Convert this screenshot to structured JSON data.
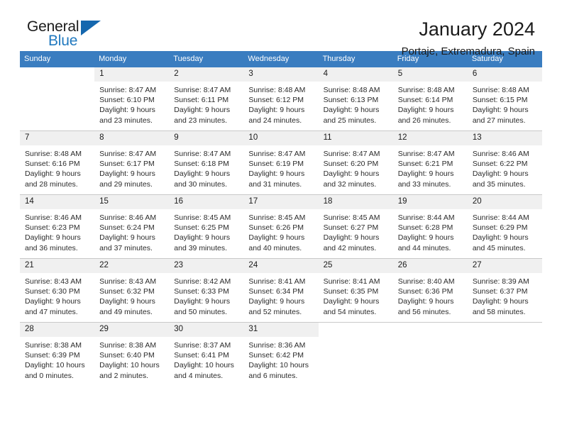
{
  "brand": {
    "word_general": "General",
    "word_blue": "Blue",
    "accent_color": "#1567ae"
  },
  "header": {
    "title": "January 2024",
    "location": "Portaje, Extremadura, Spain",
    "header_bg": "#3a7dc0",
    "daynum_bg": "#f0f0f0"
  },
  "weekdays": [
    "Sunday",
    "Monday",
    "Tuesday",
    "Wednesday",
    "Thursday",
    "Friday",
    "Saturday"
  ],
  "weeks": [
    [
      {
        "day": "",
        "sunrise": "",
        "sunset": "",
        "daylight1": "",
        "daylight2": ""
      },
      {
        "day": "1",
        "sunrise": "Sunrise: 8:47 AM",
        "sunset": "Sunset: 6:10 PM",
        "daylight1": "Daylight: 9 hours",
        "daylight2": "and 23 minutes."
      },
      {
        "day": "2",
        "sunrise": "Sunrise: 8:47 AM",
        "sunset": "Sunset: 6:11 PM",
        "daylight1": "Daylight: 9 hours",
        "daylight2": "and 23 minutes."
      },
      {
        "day": "3",
        "sunrise": "Sunrise: 8:48 AM",
        "sunset": "Sunset: 6:12 PM",
        "daylight1": "Daylight: 9 hours",
        "daylight2": "and 24 minutes."
      },
      {
        "day": "4",
        "sunrise": "Sunrise: 8:48 AM",
        "sunset": "Sunset: 6:13 PM",
        "daylight1": "Daylight: 9 hours",
        "daylight2": "and 25 minutes."
      },
      {
        "day": "5",
        "sunrise": "Sunrise: 8:48 AM",
        "sunset": "Sunset: 6:14 PM",
        "daylight1": "Daylight: 9 hours",
        "daylight2": "and 26 minutes."
      },
      {
        "day": "6",
        "sunrise": "Sunrise: 8:48 AM",
        "sunset": "Sunset: 6:15 PM",
        "daylight1": "Daylight: 9 hours",
        "daylight2": "and 27 minutes."
      }
    ],
    [
      {
        "day": "7",
        "sunrise": "Sunrise: 8:48 AM",
        "sunset": "Sunset: 6:16 PM",
        "daylight1": "Daylight: 9 hours",
        "daylight2": "and 28 minutes."
      },
      {
        "day": "8",
        "sunrise": "Sunrise: 8:47 AM",
        "sunset": "Sunset: 6:17 PM",
        "daylight1": "Daylight: 9 hours",
        "daylight2": "and 29 minutes."
      },
      {
        "day": "9",
        "sunrise": "Sunrise: 8:47 AM",
        "sunset": "Sunset: 6:18 PM",
        "daylight1": "Daylight: 9 hours",
        "daylight2": "and 30 minutes."
      },
      {
        "day": "10",
        "sunrise": "Sunrise: 8:47 AM",
        "sunset": "Sunset: 6:19 PM",
        "daylight1": "Daylight: 9 hours",
        "daylight2": "and 31 minutes."
      },
      {
        "day": "11",
        "sunrise": "Sunrise: 8:47 AM",
        "sunset": "Sunset: 6:20 PM",
        "daylight1": "Daylight: 9 hours",
        "daylight2": "and 32 minutes."
      },
      {
        "day": "12",
        "sunrise": "Sunrise: 8:47 AM",
        "sunset": "Sunset: 6:21 PM",
        "daylight1": "Daylight: 9 hours",
        "daylight2": "and 33 minutes."
      },
      {
        "day": "13",
        "sunrise": "Sunrise: 8:46 AM",
        "sunset": "Sunset: 6:22 PM",
        "daylight1": "Daylight: 9 hours",
        "daylight2": "and 35 minutes."
      }
    ],
    [
      {
        "day": "14",
        "sunrise": "Sunrise: 8:46 AM",
        "sunset": "Sunset: 6:23 PM",
        "daylight1": "Daylight: 9 hours",
        "daylight2": "and 36 minutes."
      },
      {
        "day": "15",
        "sunrise": "Sunrise: 8:46 AM",
        "sunset": "Sunset: 6:24 PM",
        "daylight1": "Daylight: 9 hours",
        "daylight2": "and 37 minutes."
      },
      {
        "day": "16",
        "sunrise": "Sunrise: 8:45 AM",
        "sunset": "Sunset: 6:25 PM",
        "daylight1": "Daylight: 9 hours",
        "daylight2": "and 39 minutes."
      },
      {
        "day": "17",
        "sunrise": "Sunrise: 8:45 AM",
        "sunset": "Sunset: 6:26 PM",
        "daylight1": "Daylight: 9 hours",
        "daylight2": "and 40 minutes."
      },
      {
        "day": "18",
        "sunrise": "Sunrise: 8:45 AM",
        "sunset": "Sunset: 6:27 PM",
        "daylight1": "Daylight: 9 hours",
        "daylight2": "and 42 minutes."
      },
      {
        "day": "19",
        "sunrise": "Sunrise: 8:44 AM",
        "sunset": "Sunset: 6:28 PM",
        "daylight1": "Daylight: 9 hours",
        "daylight2": "and 44 minutes."
      },
      {
        "day": "20",
        "sunrise": "Sunrise: 8:44 AM",
        "sunset": "Sunset: 6:29 PM",
        "daylight1": "Daylight: 9 hours",
        "daylight2": "and 45 minutes."
      }
    ],
    [
      {
        "day": "21",
        "sunrise": "Sunrise: 8:43 AM",
        "sunset": "Sunset: 6:30 PM",
        "daylight1": "Daylight: 9 hours",
        "daylight2": "and 47 minutes."
      },
      {
        "day": "22",
        "sunrise": "Sunrise: 8:43 AM",
        "sunset": "Sunset: 6:32 PM",
        "daylight1": "Daylight: 9 hours",
        "daylight2": "and 49 minutes."
      },
      {
        "day": "23",
        "sunrise": "Sunrise: 8:42 AM",
        "sunset": "Sunset: 6:33 PM",
        "daylight1": "Daylight: 9 hours",
        "daylight2": "and 50 minutes."
      },
      {
        "day": "24",
        "sunrise": "Sunrise: 8:41 AM",
        "sunset": "Sunset: 6:34 PM",
        "daylight1": "Daylight: 9 hours",
        "daylight2": "and 52 minutes."
      },
      {
        "day": "25",
        "sunrise": "Sunrise: 8:41 AM",
        "sunset": "Sunset: 6:35 PM",
        "daylight1": "Daylight: 9 hours",
        "daylight2": "and 54 minutes."
      },
      {
        "day": "26",
        "sunrise": "Sunrise: 8:40 AM",
        "sunset": "Sunset: 6:36 PM",
        "daylight1": "Daylight: 9 hours",
        "daylight2": "and 56 minutes."
      },
      {
        "day": "27",
        "sunrise": "Sunrise: 8:39 AM",
        "sunset": "Sunset: 6:37 PM",
        "daylight1": "Daylight: 9 hours",
        "daylight2": "and 58 minutes."
      }
    ],
    [
      {
        "day": "28",
        "sunrise": "Sunrise: 8:38 AM",
        "sunset": "Sunset: 6:39 PM",
        "daylight1": "Daylight: 10 hours",
        "daylight2": "and 0 minutes."
      },
      {
        "day": "29",
        "sunrise": "Sunrise: 8:38 AM",
        "sunset": "Sunset: 6:40 PM",
        "daylight1": "Daylight: 10 hours",
        "daylight2": "and 2 minutes."
      },
      {
        "day": "30",
        "sunrise": "Sunrise: 8:37 AM",
        "sunset": "Sunset: 6:41 PM",
        "daylight1": "Daylight: 10 hours",
        "daylight2": "and 4 minutes."
      },
      {
        "day": "31",
        "sunrise": "Sunrise: 8:36 AM",
        "sunset": "Sunset: 6:42 PM",
        "daylight1": "Daylight: 10 hours",
        "daylight2": "and 6 minutes."
      },
      {
        "day": "",
        "sunrise": "",
        "sunset": "",
        "daylight1": "",
        "daylight2": ""
      },
      {
        "day": "",
        "sunrise": "",
        "sunset": "",
        "daylight1": "",
        "daylight2": ""
      },
      {
        "day": "",
        "sunrise": "",
        "sunset": "",
        "daylight1": "",
        "daylight2": ""
      }
    ]
  ]
}
